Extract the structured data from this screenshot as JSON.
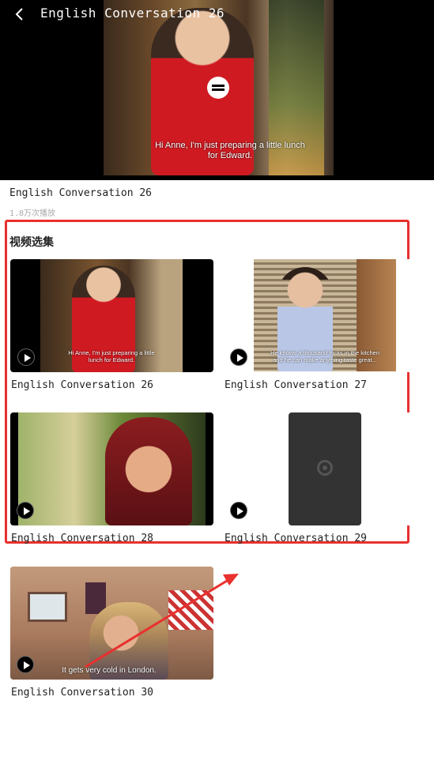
{
  "header": {
    "title": "English Conversation 26"
  },
  "player": {
    "subtitle": "Hi Anne, I'm just preparing a little lunch for Edward."
  },
  "video": {
    "title": "English Conversation 26",
    "views": "1.8万次播放"
  },
  "episodes": {
    "section_title": "视频选集",
    "items": [
      {
        "label": "English Conversation 26",
        "subtitle": "Hi Anne, I'm just preparing a little lunch for Edward."
      },
      {
        "label": "English Conversation 27",
        "subtitle": "He knows a thousand tricks in the kitchen and he can make anything taste great..."
      },
      {
        "label": "English Conversation 28",
        "subtitle": ""
      },
      {
        "label": "English Conversation 29",
        "subtitle": ""
      },
      {
        "label": "English Conversation 30",
        "subtitle": "It gets very cold in London."
      }
    ]
  },
  "colors": {
    "highlight": "#e8312f",
    "arrow": "#e8312f"
  }
}
